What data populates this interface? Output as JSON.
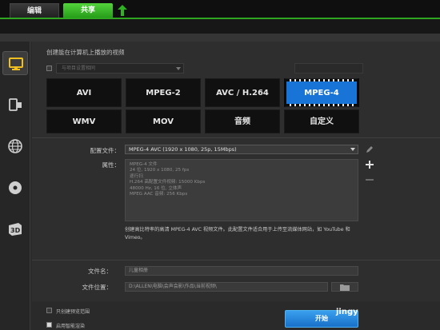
{
  "tabs": {
    "edit": "编辑",
    "share": "共享"
  },
  "sidebar": {
    "items": [
      "computer-icon",
      "device-icon",
      "globe-icon",
      "disc-icon",
      "3d-icon"
    ]
  },
  "section": {
    "heading": "创建能在计算机上播放的视频",
    "match_label": "与项目设置相同"
  },
  "formats": {
    "row1": [
      "AVI",
      "MPEG-2",
      "AVC / H.264",
      "MPEG-4"
    ],
    "row2": [
      "WMV",
      "MOV",
      "音频",
      "自定义"
    ],
    "selected": "MPEG-4"
  },
  "settings": {
    "profile_label": "配置文件：",
    "profile_value": "MPEG-4 AVC (1920 x 1080, 25p, 15Mbps)",
    "properties_label": "属性：",
    "properties_lines": [
      "MPEG-4 文件",
      "24 位, 1920 x 1080, 25 fps",
      "逐行扫",
      "H.264 高配置文件视频: 15000 Kbps",
      "48000 Hz, 16 位, 立体声",
      "MPEG AAC 音频: 256 Kbps"
    ],
    "description": "创建高比特率的高清 MPEG-4 AVC 视频文件。此配置文件适合用于上传至流媒体网站，如 YouTube 和 Vimeo。"
  },
  "output": {
    "filename_label": "文件名：",
    "filename_value": "儿童相册",
    "location_label": "文件位置：",
    "location_value": "D:\\ALLEN\\电脑\\会声会影\\作品\\当前视频\\"
  },
  "bottom": {
    "option1": "只创建预览范围",
    "option2": "启用智能渲染",
    "start": "开始",
    "watermark": "jingy"
  },
  "colors": {
    "accent_green": "#2fa61f",
    "selected_blue": "#1874d6",
    "start_blue": "#2a8ee0"
  }
}
